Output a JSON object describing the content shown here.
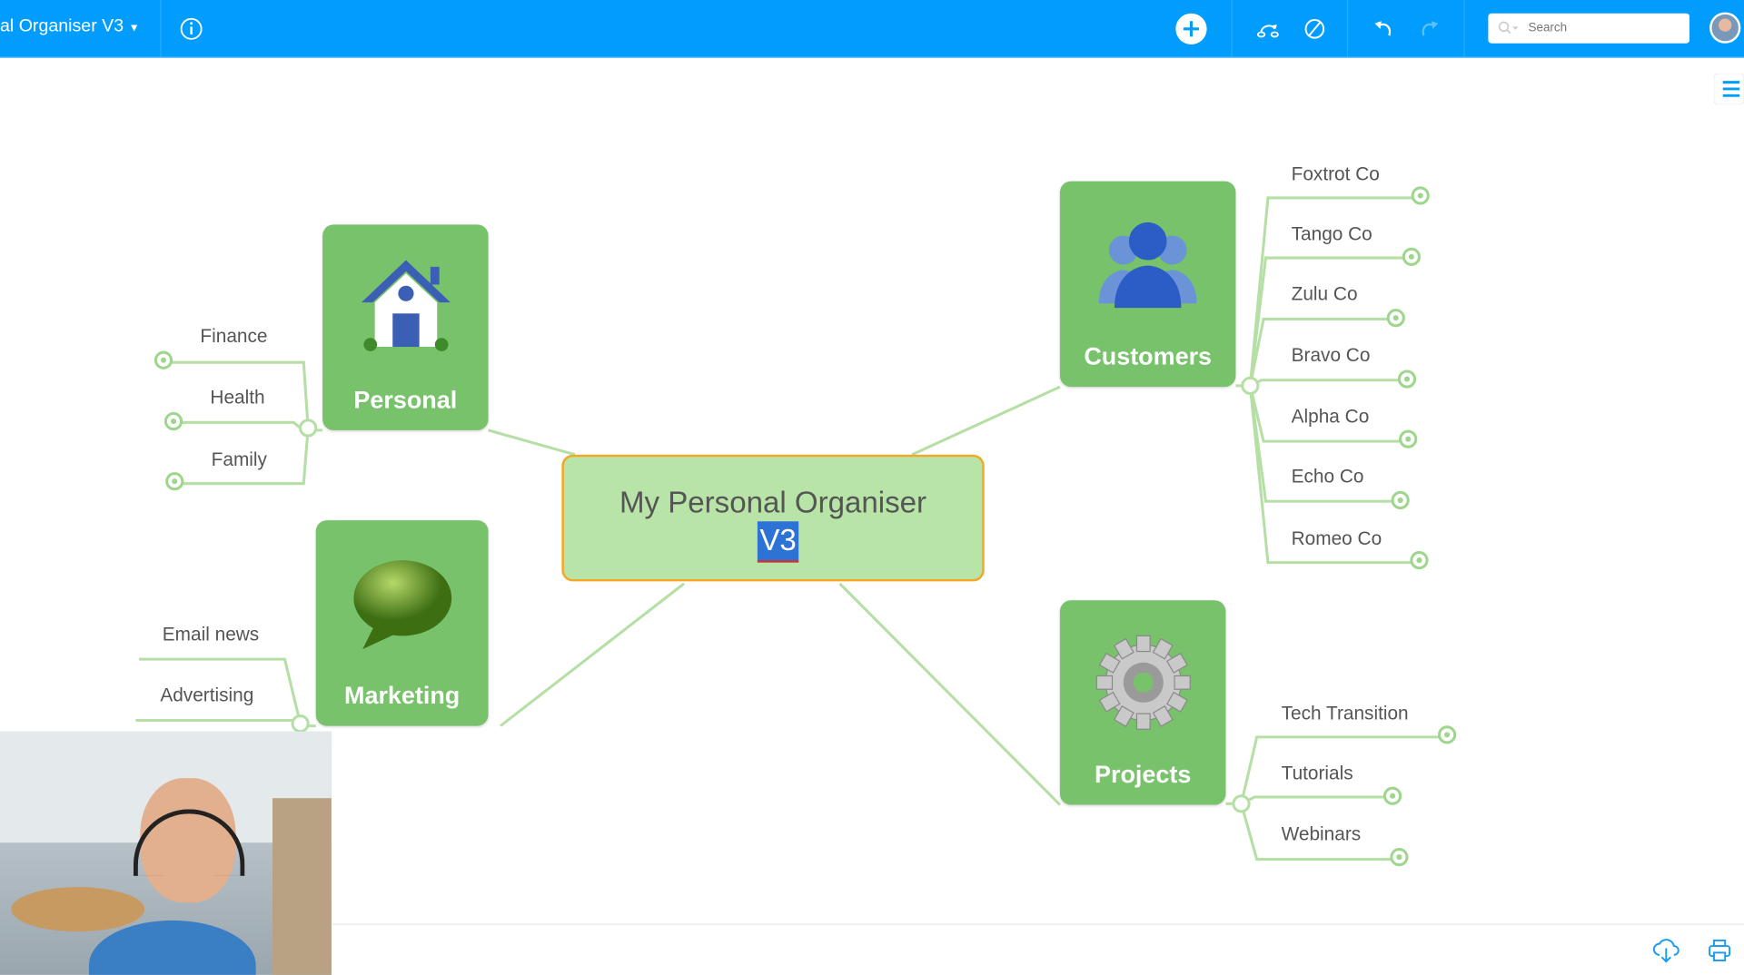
{
  "topbar": {
    "title": "al Organiser V3",
    "search_placeholder": "Search",
    "color": "#009dff",
    "icons": [
      "info-icon",
      "add-icon",
      "connect-icon",
      "disable-icon",
      "undo-icon",
      "redo-icon",
      "search-icon",
      "user-avatar"
    ]
  },
  "map": {
    "central": {
      "line1": "My Personal Organiser",
      "line2": "V3"
    },
    "branches": [
      {
        "label": "Personal",
        "icon": "house-icon",
        "children": [
          "Finance",
          "Health",
          "Family"
        ]
      },
      {
        "label": "Marketing",
        "icon": "speech-bubble-icon",
        "children": [
          "Email news",
          "Advertising"
        ]
      },
      {
        "label": "Customers",
        "icon": "people-icon",
        "children": [
          "Foxtrot Co",
          "Tango Co",
          "Zulu Co",
          "Bravo Co",
          "Alpha Co",
          "Echo Co",
          "Romeo Co"
        ]
      },
      {
        "label": "Projects",
        "icon": "gear-icon",
        "children": [
          "Tech Transition",
          "Tutorials",
          "Webinars"
        ]
      }
    ],
    "colors": {
      "node": "#77c26a",
      "central": "#b9e4a8",
      "selection_border": "#f5a623",
      "line": "#b5dfa5"
    }
  },
  "footer": {
    "icons": [
      "cloud-download-icon",
      "print-icon"
    ]
  }
}
